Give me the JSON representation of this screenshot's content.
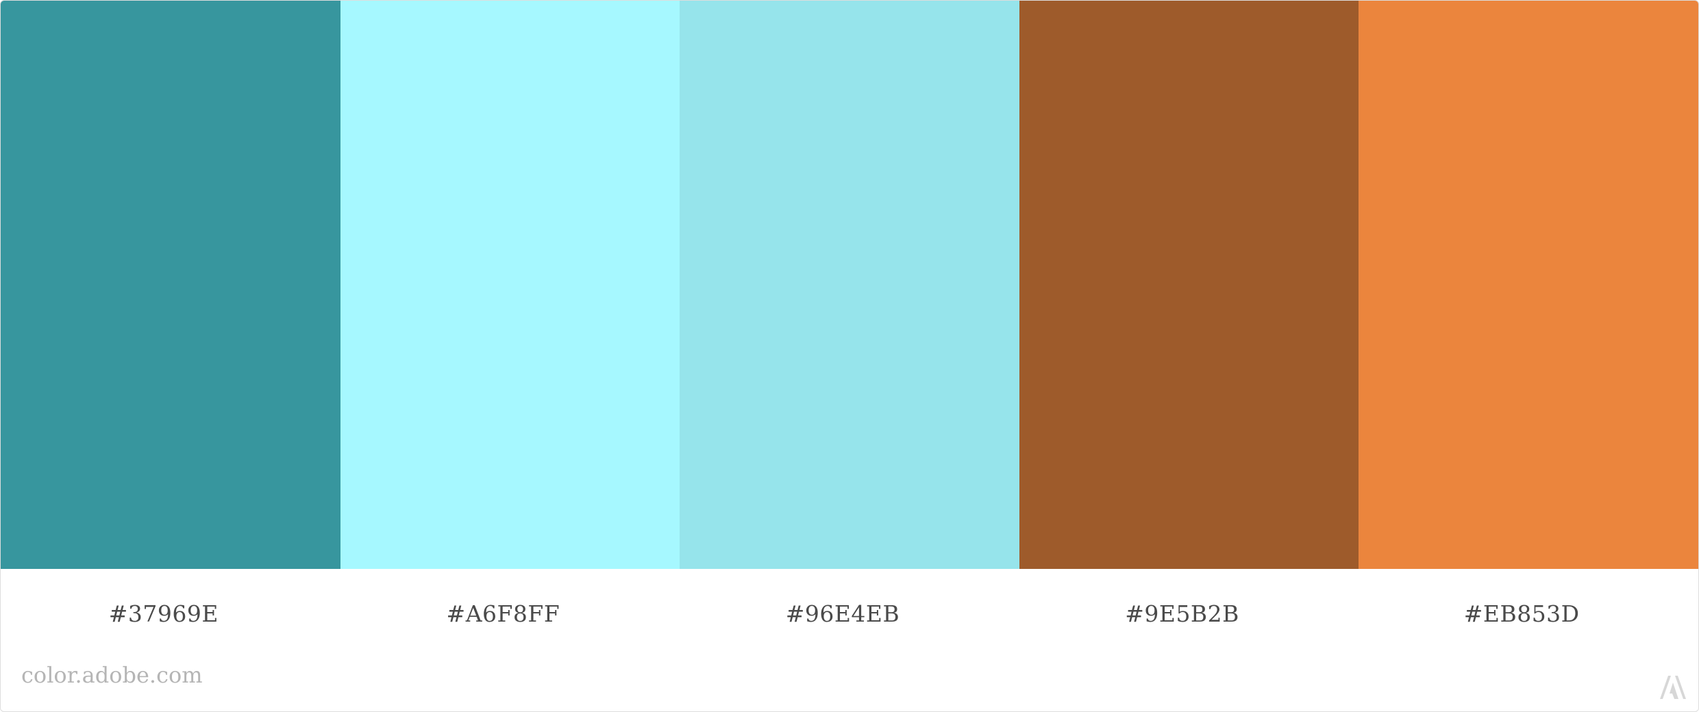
{
  "palette": {
    "swatches": [
      {
        "hex_label": "#37969E",
        "color": "#37969E"
      },
      {
        "hex_label": "#A6F8FF",
        "color": "#A6F8FF"
      },
      {
        "hex_label": "#96E4EB",
        "color": "#96E4EB"
      },
      {
        "hex_label": "#9E5B2B",
        "color": "#9E5B2B"
      },
      {
        "hex_label": "#EB853D",
        "color": "#EB853D"
      }
    ]
  },
  "footer": {
    "site_text": "color.adobe.com",
    "logo_icon": "adobe-logo-icon"
  }
}
